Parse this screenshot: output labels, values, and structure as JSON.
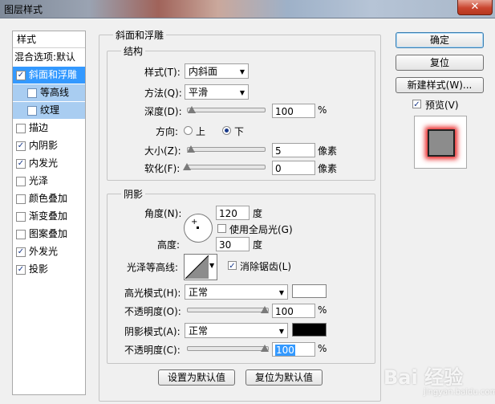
{
  "window": {
    "title": "图层样式",
    "close_glyph": "✕"
  },
  "left_panel": {
    "header": "样式",
    "blend_options": "混合选项:默认",
    "items": [
      {
        "label": "斜面和浮雕",
        "checked": true,
        "selected": true
      },
      {
        "label": "等高线",
        "checked": false,
        "sub": true
      },
      {
        "label": "纹理",
        "checked": false,
        "sub": true
      },
      {
        "label": "描边",
        "checked": false
      },
      {
        "label": "内阴影",
        "checked": true
      },
      {
        "label": "内发光",
        "checked": true
      },
      {
        "label": "光泽",
        "checked": false
      },
      {
        "label": "颜色叠加",
        "checked": false
      },
      {
        "label": "渐变叠加",
        "checked": false
      },
      {
        "label": "图案叠加",
        "checked": false
      },
      {
        "label": "外发光",
        "checked": true
      },
      {
        "label": "投影",
        "checked": true
      }
    ]
  },
  "bevel": {
    "title": "斜面和浮雕",
    "structure": {
      "title": "结构",
      "style_label": "样式(T):",
      "style_value": "内斜面",
      "technique_label": "方法(Q):",
      "technique_value": "平滑",
      "depth_label": "深度(D):",
      "depth_value": "100",
      "depth_unit": "%",
      "direction_label": "方向:",
      "direction_up": "上",
      "direction_down": "下",
      "size_label": "大小(Z):",
      "size_value": "5",
      "size_unit": "像素",
      "soften_label": "软化(F):",
      "soften_value": "0",
      "soften_unit": "像素"
    },
    "shading": {
      "title": "阴影",
      "angle_label": "角度(N):",
      "angle_value": "120",
      "angle_unit": "度",
      "global_light_label": "使用全局光(G)",
      "global_light_checked": false,
      "altitude_label": "高度:",
      "altitude_value": "30",
      "altitude_unit": "度",
      "gloss_contour_label": "光泽等高线:",
      "anti_aliased_label": "消除锯齿(L)",
      "anti_aliased_checked": true,
      "highlight_mode_label": "高光模式(H):",
      "highlight_mode_value": "正常",
      "highlight_color": "#ffffff",
      "highlight_opacity_label": "不透明度(O):",
      "highlight_opacity_value": "100",
      "highlight_opacity_unit": "%",
      "shadow_mode_label": "阴影模式(A):",
      "shadow_mode_value": "正常",
      "shadow_color": "#000000",
      "shadow_opacity_label": "不透明度(C):",
      "shadow_opacity_value": "100",
      "shadow_opacity_unit": "%"
    },
    "make_default": "设置为默认值",
    "reset_default": "复位为默认值"
  },
  "right_panel": {
    "ok": "确定",
    "reset": "复位",
    "new_style": "新建样式(W)...",
    "preview_label": "预览(V)",
    "preview_checked": true
  },
  "watermark": {
    "text": "Bai 经验",
    "sub": "jingyan.baidu.com"
  }
}
